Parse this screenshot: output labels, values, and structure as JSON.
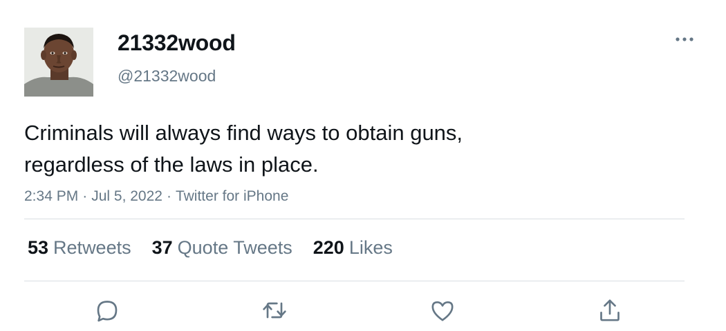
{
  "author": {
    "display_name": "21332wood",
    "handle": "@21332wood"
  },
  "tweet": {
    "text": "Criminals will always find ways to obtain guns,\nregardless of the laws in place.",
    "time": "2:34 PM",
    "date": "Jul 5, 2022",
    "source": "Twitter for iPhone",
    "separator": "·"
  },
  "stats": {
    "retweets": {
      "count": "53",
      "label": "Retweets"
    },
    "quote_tweets": {
      "count": "37",
      "label": "Quote Tweets"
    },
    "likes": {
      "count": "220",
      "label": "Likes"
    }
  },
  "actions": {
    "reply_icon": "reply-icon",
    "retweet_icon": "retweet-icon",
    "like_icon": "heart-icon",
    "share_icon": "share-icon",
    "more_icon": "more-icon"
  },
  "colors": {
    "text_primary": "#0f1419",
    "text_secondary": "#657786",
    "divider": "#d9dee2",
    "icon": "#657786"
  }
}
